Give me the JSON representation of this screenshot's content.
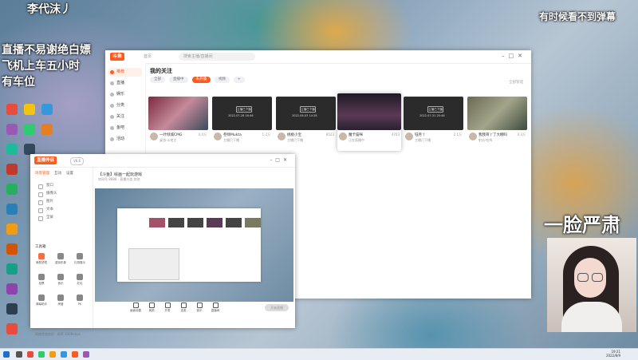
{
  "overlays": {
    "streamer_name": "李代沫丿",
    "top_right_note": "有时候看不到弹幕",
    "left_line1": "直播不易谢绝白嫖",
    "left_line2": "飞机上车五小时",
    "left_line3": "有车位",
    "right_big": "一脸严肃"
  },
  "main_window": {
    "logo": "斗鱼",
    "nav_text": "首页",
    "search_placeholder": "搜索主播/直播间",
    "sidebar": [
      "推荐",
      "直播",
      "娱乐",
      "分类",
      "关注",
      "鱼吧",
      "活动"
    ],
    "section_title": "我的关注",
    "filters": [
      "全部",
      "直播中",
      "未开播",
      "视频",
      "+"
    ],
    "refresh_text": "全部管理",
    "cards": [
      {
        "name": "一叶倾城CMG",
        "sub": "桌游·斗地主",
        "num": "4.0万",
        "live_label": "",
        "time": ""
      },
      {
        "name": "叁倾Mukta",
        "sub": "主播已下播",
        "num": "1.2万",
        "live_label": "主播已下播",
        "time": "2022-07-28 18:46"
      },
      {
        "name": "桃桃小宝",
        "sub": "主播已下播",
        "num": "8523",
        "live_label": "主播已下播",
        "time": "2022-08-03 14:28"
      },
      {
        "name": "魔卡猫咪",
        "sub": "正在直播中",
        "num": "4703",
        "live_label": "",
        "time": ""
      },
      {
        "name": "钰月丫",
        "sub": "主播已下播",
        "num": "2.1万",
        "live_label": "主播已下播",
        "time": "2022-07-31 20:48"
      },
      {
        "name": "我我哥丫了大棚吗",
        "sub": "射击·吃鸡",
        "num": "3.3万",
        "live_label": "",
        "time": ""
      }
    ]
  },
  "small_window": {
    "logo": "直播伴侣",
    "badge": "V6.6",
    "tabs": [
      "场景管理",
      "互动",
      "设置"
    ],
    "list_items": [
      "窗口",
      "摄像头",
      "图片",
      "文本",
      "全屏"
    ],
    "tools_label": "工具箱",
    "tools": [
      "美颜滤镜",
      "虚拟形象",
      "礼物展示",
      "投票",
      "音乐",
      "红包",
      "弹幕助手",
      "房管",
      "PK"
    ],
    "status": "网络状态良好 · 码率 3500kbps",
    "stream_title": "【斗鱼】绘画一起玩游戏",
    "stream_meta": "房间号 8888 · 直播分类 其他",
    "bottom_tools": [
      "画面设置",
      "美颜",
      "开麦",
      "连麦",
      "音乐",
      "直播间"
    ],
    "start_btn": "开始直播"
  },
  "taskbar": {
    "time": "19:21",
    "date": "2022/8/9"
  }
}
